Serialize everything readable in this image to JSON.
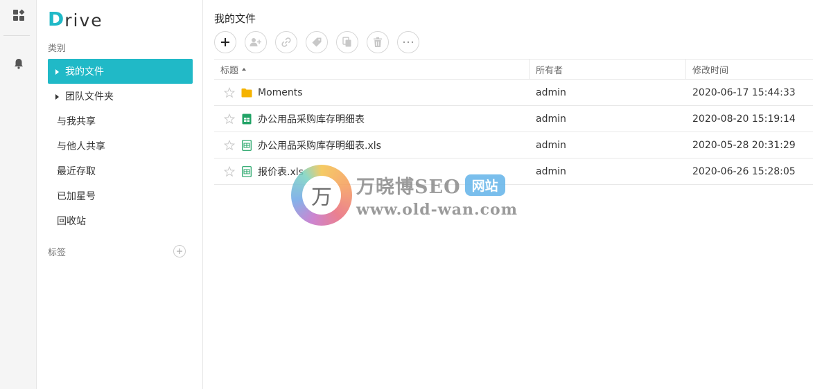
{
  "rail": {
    "icons": [
      "apps-grid-icon",
      "bell-icon"
    ]
  },
  "sidebar": {
    "logo_first": "D",
    "logo_rest": "rive",
    "category_title": "类别",
    "items": [
      {
        "label": "我的文件",
        "active": true,
        "caret": true
      },
      {
        "label": "团队文件夹",
        "active": false,
        "caret": true
      },
      {
        "label": "与我共享",
        "active": false,
        "caret": false
      },
      {
        "label": "与他人共享",
        "active": false,
        "caret": false
      },
      {
        "label": "最近存取",
        "active": false,
        "caret": false
      },
      {
        "label": "已加星号",
        "active": false,
        "caret": false
      },
      {
        "label": "回收站",
        "active": false,
        "caret": false
      }
    ],
    "tag_title": "标签"
  },
  "main": {
    "breadcrumb": "我的文件",
    "toolbar": [
      "plus-icon",
      "share-user-icon",
      "link-icon",
      "tag-icon",
      "copy-icon",
      "trash-icon",
      "more-icon"
    ],
    "columns": {
      "title": "标题",
      "owner": "所有者",
      "modified": "修改时间"
    },
    "rows": [
      {
        "name": "Moments",
        "type": "folder",
        "owner": "admin",
        "modified": "2020-06-17 15:44:33"
      },
      {
        "name": "办公用品采购库存明细表",
        "type": "sheet",
        "owner": "admin",
        "modified": "2020-08-20 15:19:14"
      },
      {
        "name": "办公用品采购库存明细表.xls",
        "type": "xls",
        "owner": "admin",
        "modified": "2020-05-28 20:31:29"
      },
      {
        "name": "报价表.xls",
        "type": "xls",
        "owner": "admin",
        "modified": "2020-06-26 15:28:05"
      }
    ]
  },
  "colors": {
    "accent": "#20b9c7",
    "folder": "#f5b300",
    "sheet": "#21a366"
  },
  "watermark": {
    "logo_char": "万",
    "name": "万晓博SEO",
    "badge": "网站",
    "url": "www.old-wan.com"
  }
}
